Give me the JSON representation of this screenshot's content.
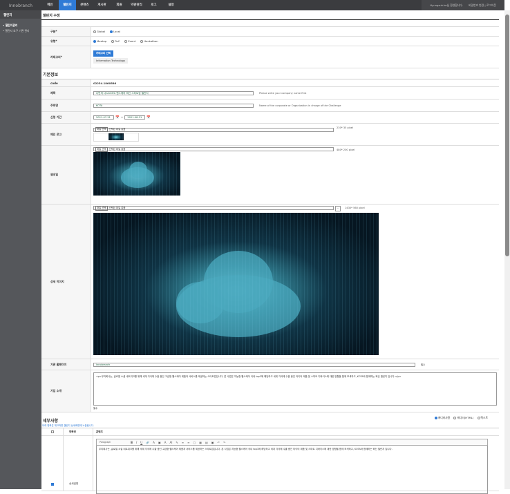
{
  "header": {
    "logo": "Innobranch",
    "nav": [
      "메인",
      "챌린지",
      "콘텐츠",
      "게시판",
      "회원",
      "약관관리",
      "로그",
      "설정"
    ],
    "active": 1,
    "welcome": "Hyungsuk.ko님 환영합니다.",
    "change_pw": "비밀번호 변경",
    "logout": "로그아웃"
  },
  "sidebar": {
    "title": "챌린지",
    "items": [
      "챌린지관리",
      "챌린지 요구 기관 관리"
    ]
  },
  "page": {
    "title": "챌린지 수정"
  },
  "form": {
    "division": {
      "label": "구분*",
      "options": [
        "Global",
        "Local"
      ],
      "selected": "Local"
    },
    "type": {
      "label": "유형*",
      "options": [
        "Meetup",
        "PoC",
        "Event",
        "Hackathon"
      ],
      "selected": "Meetup"
    },
    "category": {
      "label": "카테고리*",
      "button": "카테고리 선택",
      "selected": "Information Technology"
    }
  },
  "basic": {
    "heading": "기본정보",
    "code": {
      "label": "code",
      "value": "02254.1860586"
    },
    "title": {
      "label": "제목",
      "value": "나만의 나노KOITA 랜스케어 혁신 스타트업 챌린지",
      "hint": "Please write your company name first"
    },
    "host": {
      "label": "주최명",
      "value": "KOTA",
      "hint": "Name of the corporate or Organization in charge of the Challenge"
    },
    "period": {
      "label": "신청 기간",
      "start": "2021-07-31",
      "end": "2021-08-31",
      "sep": "~"
    },
    "logo": {
      "label": "메인 로고",
      "file_button": "파일 선택",
      "file_text": "선택된 파일 없음",
      "hint": "230*  35 pixel"
    },
    "thumb": {
      "label": "썸네일",
      "file_button": "파일 선택",
      "file_text": "선택된 파일 없음",
      "hint": "480*  200 pixel"
    },
    "detail": {
      "label": "상세 이미지",
      "file_button": "파일 선택",
      "file_text": "선택된 파일 없음",
      "remove": "-",
      "hint": "1430*  560 pixel"
    },
    "homepage": {
      "label": "기관 홈페이지",
      "value": "innobranch",
      "note": "필수"
    },
    "intro": {
      "label": "기업 소개",
      "value": "<p>우리회사는, 글로벌 소셜 네트워크를 위해 세계 각국에 수출 중인 고급형 헬스케어 제품과 서비스를 제공하는 스타트업입니다. 본 사업은 지능형 헬스케어 국내 top3에 해당하고 세계 각국에 수출 중인 타이어 제품 및 스마트 디바이스에 대한 방향을 함께 모색하고, KOTA와 함께하는 혁신 챌린지 입니다.</p>",
      "note": "필수"
    }
  },
  "details": {
    "heading": "세부사항",
    "note": "아래 항목은 체크하면 챌린지 상세화면에 노출됩니다.",
    "modes": [
      "에디터사용",
      "에디터(HTML)",
      "텍스트"
    ],
    "mode_selected": 0,
    "columns": [
      "항목명",
      "콘텐츠"
    ],
    "editor_toolbar": {
      "paragraph": "Paragraph",
      "buttons": [
        "B",
        "I",
        "U",
        "🔗",
        "A",
        "▣",
        "A",
        "AI",
        "✎",
        "≡",
        "≡",
        "▢",
        "▦",
        "▤",
        "▣",
        "↶",
        "↷"
      ]
    },
    "rows": [
      {
        "name": "상세설명",
        "checked": true,
        "content": "우리회사는, 글로벌 소셜 네트워크를 위해 세계 각국에 수출 중인 고급형 헬스케어 제품과 서비스를 제공하는 스타트업입니다. 본 사업은 지능형 헬스케어 국내 top3에 해당하고 세계 각국에 수출 중인 타이어 제품 및 스마트 디바이스에 대한 방향을 함께 모색하고, KOTA와 함께하는 혁신 챌린지 입니다."
      }
    ]
  },
  "colors": {
    "accent": "#2f7bd6",
    "topbar": "#3b3c3f",
    "sidebar": "#55575b"
  }
}
